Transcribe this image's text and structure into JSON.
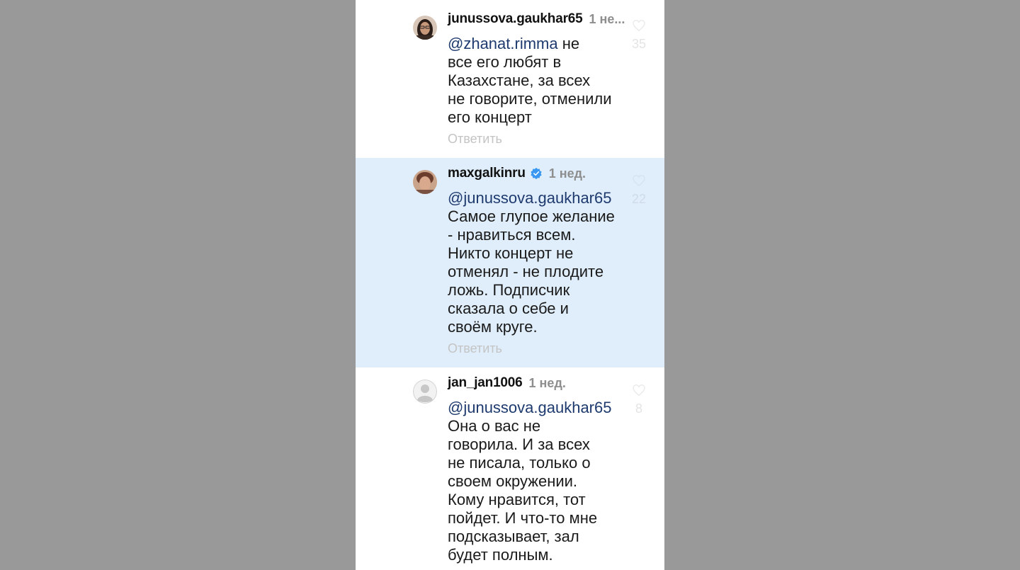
{
  "comments": [
    {
      "username": "junussova.gaukhar65",
      "time": "1 не...",
      "mention": "@zhanat.rimma",
      "lines": [
        "не",
        "все его любят в",
        "Казахстане,  за всех",
        "не говорите, отменили",
        "его концерт"
      ],
      "reply_label": "Ответить",
      "likes": "35",
      "avatar_icon": "user-photo-woman-glasses"
    },
    {
      "username": "maxgalkinru",
      "verified_icon": "verified-badge-icon",
      "time": "1 нед.",
      "mention": "@junussova.gaukhar65",
      "lines": [
        "Самое глупое желание",
        "- нравиться всем.",
        "Никто концерт не",
        "отменял - не плодите",
        "ложь. Подписчик",
        "сказала о себе и",
        "своём круге."
      ],
      "reply_label": "Ответить",
      "likes": "22",
      "avatar_icon": "user-photo-man"
    },
    {
      "username": "jan_jan1006",
      "time": "1 нед.",
      "mention": "@junussova.gaukhar65",
      "lines": [
        "Она о вас не",
        "говорила. И за всех",
        "не писала, только о",
        "своем окружении.",
        "Кому нравится, тот",
        "пойдет. И что-то мне",
        "подсказывает, зал",
        "будет полным."
      ],
      "likes": "8",
      "avatar_icon": "default-avatar-icon"
    }
  ],
  "colors": {
    "background": "#999999",
    "highlight": "#e0eefb",
    "mention": "#1e3a6e",
    "verified": "#3897f0"
  }
}
